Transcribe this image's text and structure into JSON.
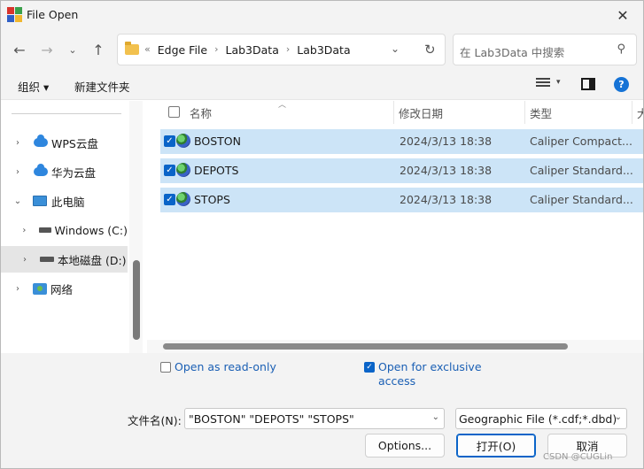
{
  "window": {
    "title": "File Open"
  },
  "nav": {
    "crumb_overflow": "«",
    "breadcrumbs": [
      "Edge File",
      "Lab3Data",
      "Lab3Data"
    ],
    "search_placeholder": "在 Lab3Data 中搜索"
  },
  "toolbar": {
    "organize_label": "组织 ▾",
    "new_folder_label": "新建文件夹"
  },
  "sidebar": {
    "items": [
      {
        "label": "WPS云盘",
        "icon": "cloud-icon"
      },
      {
        "label": "华为云盘",
        "icon": "cloud-icon"
      },
      {
        "label": "此电脑",
        "icon": "monitor-icon"
      },
      {
        "label": "Windows (C:)",
        "icon": "drive-icon"
      },
      {
        "label": "本地磁盘 (D:)",
        "icon": "drive-icon",
        "selected": true
      },
      {
        "label": "网络",
        "icon": "network-icon"
      }
    ]
  },
  "filelist": {
    "columns": {
      "name": "名称",
      "date": "修改日期",
      "type": "类型",
      "size": "大"
    },
    "rows": [
      {
        "name": "BOSTON",
        "date": "2024/3/13 18:38",
        "type": "Caliper Compact...",
        "checked": true
      },
      {
        "name": "DEPOTS",
        "date": "2024/3/13 18:38",
        "type": "Caliper Standard...",
        "checked": true
      },
      {
        "name": "STOPS",
        "date": "2024/3/13 18:38",
        "type": "Caliper Standard...",
        "checked": true
      }
    ]
  },
  "options": {
    "read_only_label": "Open as read-only",
    "exclusive_line1": "Open for exclusive",
    "exclusive_line2": "access"
  },
  "bottom": {
    "filename_label": "文件名(N):",
    "filename_value": "\"BOSTON\" \"DEPOTS\" \"STOPS\"",
    "filetype_value": "Geographic File (*.cdf;*.dbd)",
    "options_button": "Options...",
    "open_button": "打开(O)",
    "cancel_button": "取消",
    "watermark": "CSDN @CUGLin"
  },
  "colors": {
    "accent": "#0a64c8",
    "selection": "#cce4f7",
    "chrome": "#f3f3f3"
  }
}
